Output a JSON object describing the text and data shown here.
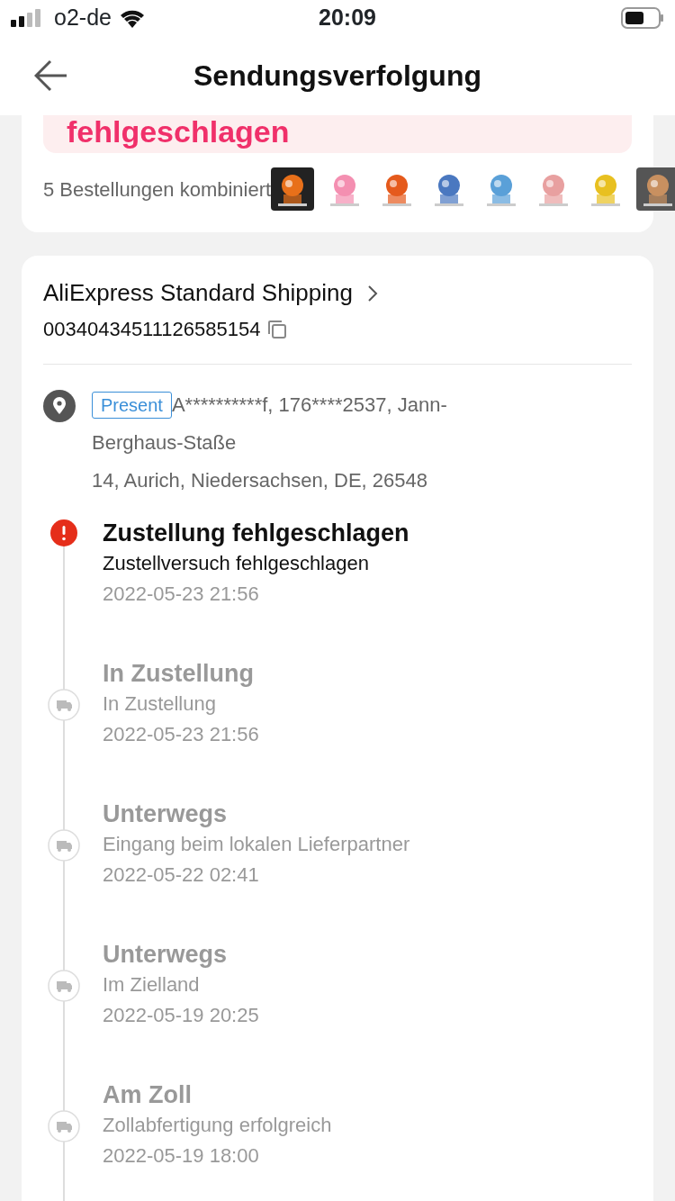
{
  "status_bar": {
    "carrier": "o2-de",
    "time": "20:09"
  },
  "header": {
    "title": "Sendungsverfolgung"
  },
  "status_banner": {
    "text": "fehlgeschlagen"
  },
  "orders": {
    "label": "5 Bestellungen kombiniert"
  },
  "shipment": {
    "carrier": "AliExpress Standard Shipping",
    "tracking_number": "00340434511126585154",
    "address_tag": "Present",
    "address_lines": [
      "A**********f,  176****2537,  Jann-",
      "Berghaus-Staße",
      "14,  Aurich,  Niedersachsen,  DE,  26548"
    ]
  },
  "events": [
    {
      "kind": "failed",
      "title": "Zustellung fehlgeschlagen",
      "detail": "Zustellversuch fehlgeschlagen",
      "time": "2022-05-23 21:56"
    },
    {
      "kind": "transit",
      "title": "In Zustellung",
      "detail": "In Zustellung",
      "time": "2022-05-23 21:56"
    },
    {
      "kind": "transit",
      "title": "Unterwegs",
      "detail": "Eingang beim lokalen Lieferpartner",
      "time": "2022-05-22 02:41"
    },
    {
      "kind": "transit",
      "title": "Unterwegs",
      "detail": "Im Zielland",
      "time": "2022-05-19 20:25"
    },
    {
      "kind": "transit",
      "title": "Am Zoll",
      "detail": "Zollabfertigung erfolgreich",
      "time": "2022-05-19 18:00"
    }
  ]
}
